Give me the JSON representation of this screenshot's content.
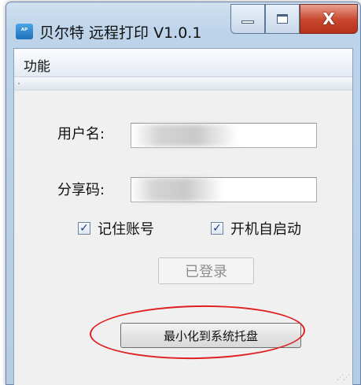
{
  "window": {
    "icon_text": "ᴬᴾ",
    "title": "贝尔特 远程打印 V1.0.1",
    "close_glyph": "X"
  },
  "menu": {
    "items": [
      {
        "label": "功能"
      }
    ]
  },
  "form": {
    "username_label": "用户名:",
    "username_value": "",
    "sharecode_label": "分享码:",
    "sharecode_value": "",
    "remember_label": "记住账号",
    "remember_checked": true,
    "autostart_label": "开机自启动",
    "autostart_checked": true,
    "checkmark": "✓"
  },
  "buttons": {
    "login_label": "已登录",
    "login_disabled": true,
    "minimize_tray_label": "最小化到系统托盘"
  },
  "colors": {
    "annotation_circle": "#e02020",
    "close_button": "#c7452c"
  }
}
